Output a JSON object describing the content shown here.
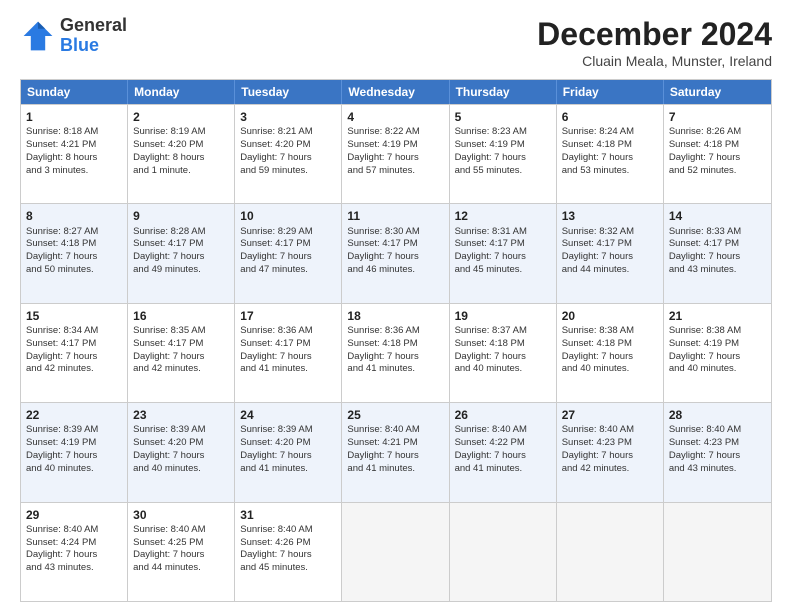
{
  "header": {
    "logo_general": "General",
    "logo_blue": "Blue",
    "month_title": "December 2024",
    "subtitle": "Cluain Meala, Munster, Ireland"
  },
  "days_of_week": [
    "Sunday",
    "Monday",
    "Tuesday",
    "Wednesday",
    "Thursday",
    "Friday",
    "Saturday"
  ],
  "rows": [
    [
      {
        "day": "1",
        "lines": [
          "Sunrise: 8:18 AM",
          "Sunset: 4:21 PM",
          "Daylight: 8 hours",
          "and 3 minutes."
        ]
      },
      {
        "day": "2",
        "lines": [
          "Sunrise: 8:19 AM",
          "Sunset: 4:20 PM",
          "Daylight: 8 hours",
          "and 1 minute."
        ]
      },
      {
        "day": "3",
        "lines": [
          "Sunrise: 8:21 AM",
          "Sunset: 4:20 PM",
          "Daylight: 7 hours",
          "and 59 minutes."
        ]
      },
      {
        "day": "4",
        "lines": [
          "Sunrise: 8:22 AM",
          "Sunset: 4:19 PM",
          "Daylight: 7 hours",
          "and 57 minutes."
        ]
      },
      {
        "day": "5",
        "lines": [
          "Sunrise: 8:23 AM",
          "Sunset: 4:19 PM",
          "Daylight: 7 hours",
          "and 55 minutes."
        ]
      },
      {
        "day": "6",
        "lines": [
          "Sunrise: 8:24 AM",
          "Sunset: 4:18 PM",
          "Daylight: 7 hours",
          "and 53 minutes."
        ]
      },
      {
        "day": "7",
        "lines": [
          "Sunrise: 8:26 AM",
          "Sunset: 4:18 PM",
          "Daylight: 7 hours",
          "and 52 minutes."
        ]
      }
    ],
    [
      {
        "day": "8",
        "lines": [
          "Sunrise: 8:27 AM",
          "Sunset: 4:18 PM",
          "Daylight: 7 hours",
          "and 50 minutes."
        ]
      },
      {
        "day": "9",
        "lines": [
          "Sunrise: 8:28 AM",
          "Sunset: 4:17 PM",
          "Daylight: 7 hours",
          "and 49 minutes."
        ]
      },
      {
        "day": "10",
        "lines": [
          "Sunrise: 8:29 AM",
          "Sunset: 4:17 PM",
          "Daylight: 7 hours",
          "and 47 minutes."
        ]
      },
      {
        "day": "11",
        "lines": [
          "Sunrise: 8:30 AM",
          "Sunset: 4:17 PM",
          "Daylight: 7 hours",
          "and 46 minutes."
        ]
      },
      {
        "day": "12",
        "lines": [
          "Sunrise: 8:31 AM",
          "Sunset: 4:17 PM",
          "Daylight: 7 hours",
          "and 45 minutes."
        ]
      },
      {
        "day": "13",
        "lines": [
          "Sunrise: 8:32 AM",
          "Sunset: 4:17 PM",
          "Daylight: 7 hours",
          "and 44 minutes."
        ]
      },
      {
        "day": "14",
        "lines": [
          "Sunrise: 8:33 AM",
          "Sunset: 4:17 PM",
          "Daylight: 7 hours",
          "and 43 minutes."
        ]
      }
    ],
    [
      {
        "day": "15",
        "lines": [
          "Sunrise: 8:34 AM",
          "Sunset: 4:17 PM",
          "Daylight: 7 hours",
          "and 42 minutes."
        ]
      },
      {
        "day": "16",
        "lines": [
          "Sunrise: 8:35 AM",
          "Sunset: 4:17 PM",
          "Daylight: 7 hours",
          "and 42 minutes."
        ]
      },
      {
        "day": "17",
        "lines": [
          "Sunrise: 8:36 AM",
          "Sunset: 4:17 PM",
          "Daylight: 7 hours",
          "and 41 minutes."
        ]
      },
      {
        "day": "18",
        "lines": [
          "Sunrise: 8:36 AM",
          "Sunset: 4:18 PM",
          "Daylight: 7 hours",
          "and 41 minutes."
        ]
      },
      {
        "day": "19",
        "lines": [
          "Sunrise: 8:37 AM",
          "Sunset: 4:18 PM",
          "Daylight: 7 hours",
          "and 40 minutes."
        ]
      },
      {
        "day": "20",
        "lines": [
          "Sunrise: 8:38 AM",
          "Sunset: 4:18 PM",
          "Daylight: 7 hours",
          "and 40 minutes."
        ]
      },
      {
        "day": "21",
        "lines": [
          "Sunrise: 8:38 AM",
          "Sunset: 4:19 PM",
          "Daylight: 7 hours",
          "and 40 minutes."
        ]
      }
    ],
    [
      {
        "day": "22",
        "lines": [
          "Sunrise: 8:39 AM",
          "Sunset: 4:19 PM",
          "Daylight: 7 hours",
          "and 40 minutes."
        ]
      },
      {
        "day": "23",
        "lines": [
          "Sunrise: 8:39 AM",
          "Sunset: 4:20 PM",
          "Daylight: 7 hours",
          "and 40 minutes."
        ]
      },
      {
        "day": "24",
        "lines": [
          "Sunrise: 8:39 AM",
          "Sunset: 4:20 PM",
          "Daylight: 7 hours",
          "and 41 minutes."
        ]
      },
      {
        "day": "25",
        "lines": [
          "Sunrise: 8:40 AM",
          "Sunset: 4:21 PM",
          "Daylight: 7 hours",
          "and 41 minutes."
        ]
      },
      {
        "day": "26",
        "lines": [
          "Sunrise: 8:40 AM",
          "Sunset: 4:22 PM",
          "Daylight: 7 hours",
          "and 41 minutes."
        ]
      },
      {
        "day": "27",
        "lines": [
          "Sunrise: 8:40 AM",
          "Sunset: 4:23 PM",
          "Daylight: 7 hours",
          "and 42 minutes."
        ]
      },
      {
        "day": "28",
        "lines": [
          "Sunrise: 8:40 AM",
          "Sunset: 4:23 PM",
          "Daylight: 7 hours",
          "and 43 minutes."
        ]
      }
    ],
    [
      {
        "day": "29",
        "lines": [
          "Sunrise: 8:40 AM",
          "Sunset: 4:24 PM",
          "Daylight: 7 hours",
          "and 43 minutes."
        ]
      },
      {
        "day": "30",
        "lines": [
          "Sunrise: 8:40 AM",
          "Sunset: 4:25 PM",
          "Daylight: 7 hours",
          "and 44 minutes."
        ]
      },
      {
        "day": "31",
        "lines": [
          "Sunrise: 8:40 AM",
          "Sunset: 4:26 PM",
          "Daylight: 7 hours",
          "and 45 minutes."
        ]
      },
      null,
      null,
      null,
      null
    ]
  ]
}
